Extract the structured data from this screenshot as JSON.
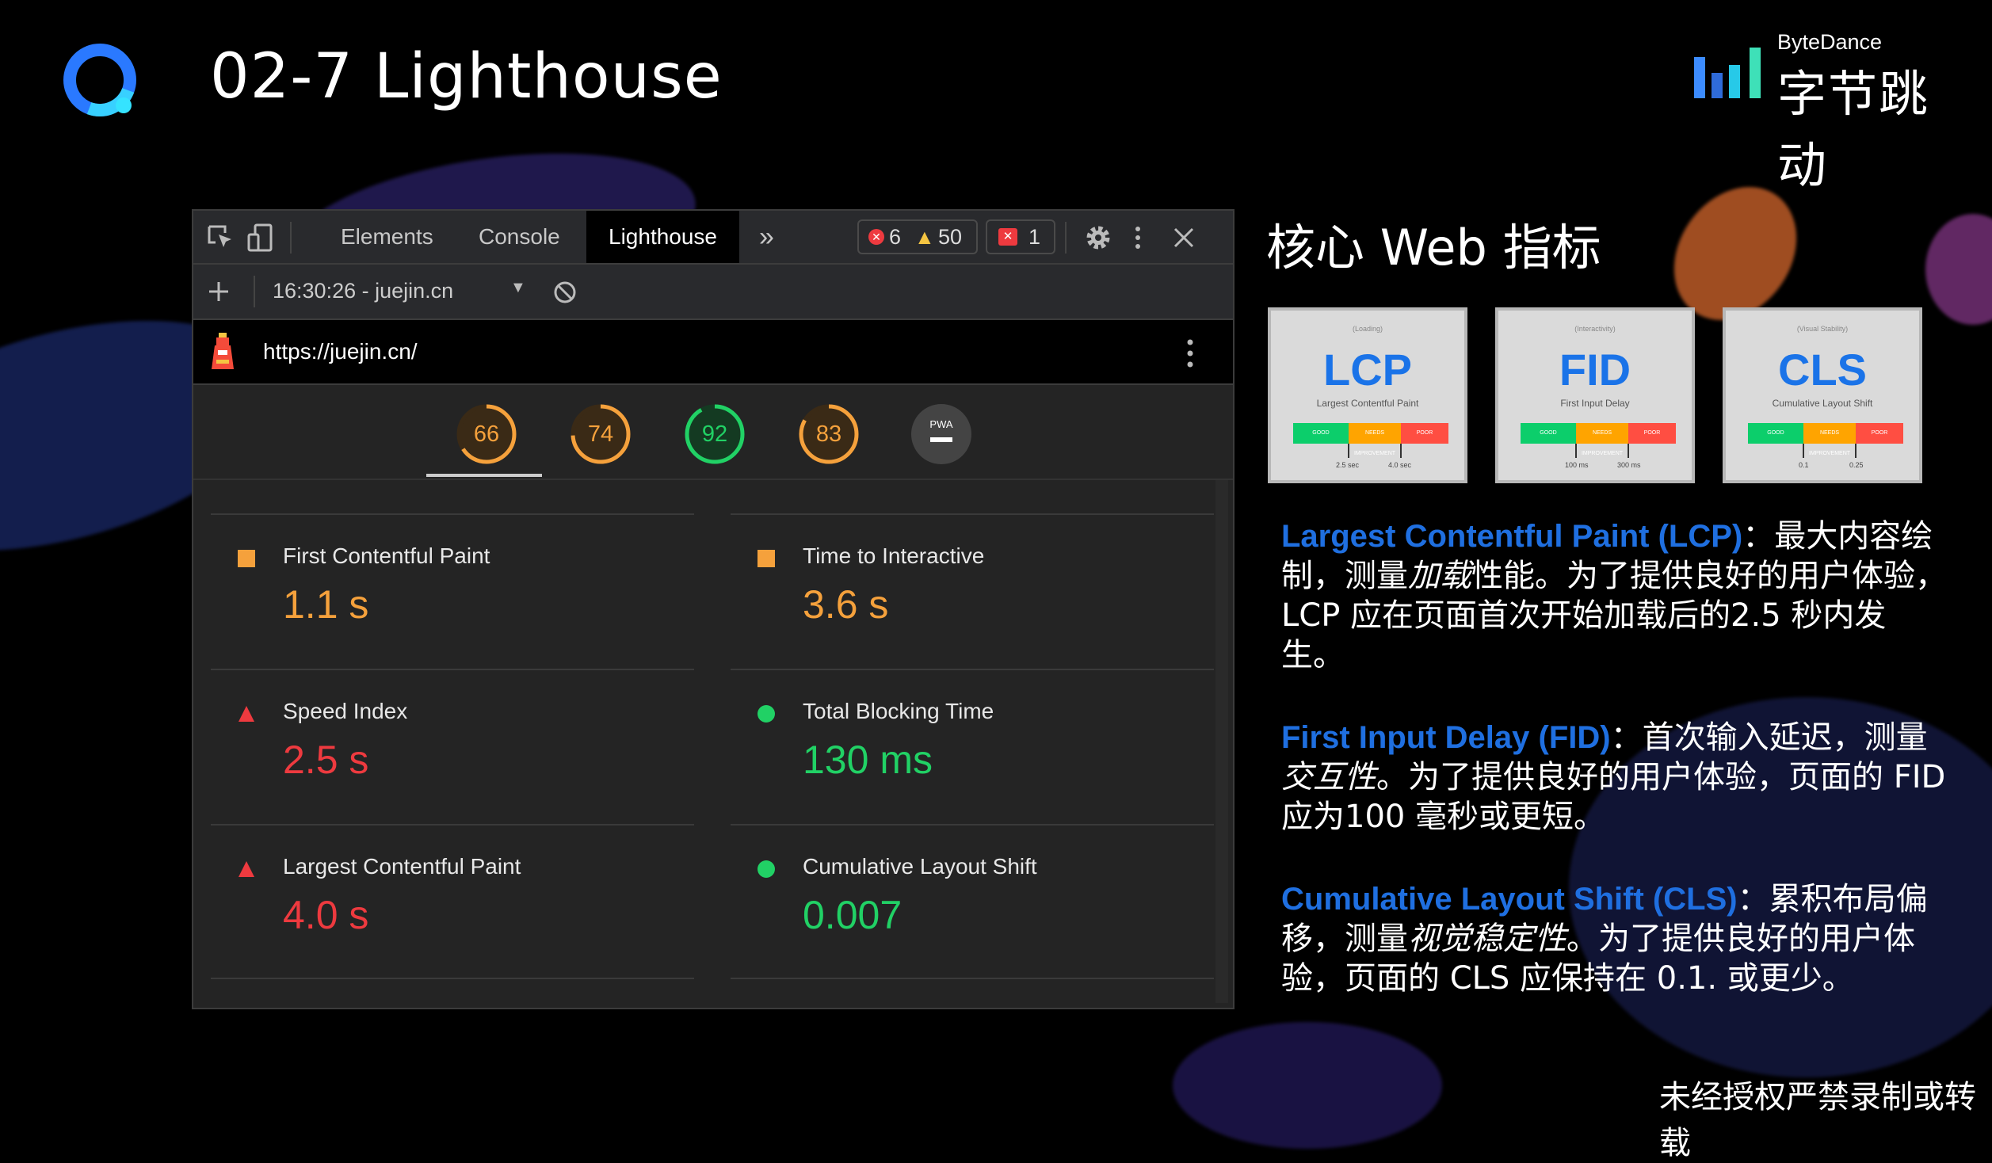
{
  "slide": {
    "title": "02-7 Lighthouse"
  },
  "brand": {
    "english": "ByteDance",
    "chinese": "字节跳动"
  },
  "devtools": {
    "tabs": [
      "Elements",
      "Console",
      "Lighthouse"
    ],
    "active_tab": "Lighthouse",
    "more_tabs": "»",
    "badges": {
      "errors": "6",
      "warnings": "50",
      "issues": "1"
    },
    "report_select": "16:30:26 - juejin.cn",
    "url": "https://juejin.cn/",
    "scores": [
      "66",
      "74",
      "92",
      "83"
    ],
    "pwa_label": "PWA",
    "metrics": [
      {
        "label": "First Contentful Paint",
        "value": "1.1 s",
        "status": "orange"
      },
      {
        "label": "Time to Interactive",
        "value": "3.6 s",
        "status": "orange"
      },
      {
        "label": "Speed Index",
        "value": "2.5 s",
        "status": "red"
      },
      {
        "label": "Total Blocking Time",
        "value": "130 ms",
        "status": "green"
      },
      {
        "label": "Largest Contentful Paint",
        "value": "4.0 s",
        "status": "red"
      },
      {
        "label": "Cumulative Layout Shift",
        "value": "0.007",
        "status": "green"
      }
    ]
  },
  "right": {
    "heading": "核心 Web 指标",
    "cards": [
      {
        "category": "(Loading)",
        "abbr": "LCP",
        "full": "Largest Contentful Paint",
        "t1": "2.5 sec",
        "t2": "4.0 sec"
      },
      {
        "category": "(Interactivity)",
        "abbr": "FID",
        "full": "First Input Delay",
        "t1": "100 ms",
        "t2": "300 ms"
      },
      {
        "category": "(Visual Stability)",
        "abbr": "CLS",
        "full": "Cumulative Layout Shift",
        "t1": "0.1",
        "t2": "0.25"
      }
    ],
    "bar_labels": {
      "good": "GOOD",
      "needs": "NEEDS IMPROVEMENT",
      "poor": "POOR"
    },
    "lcp": {
      "kw": "Largest Contentful Paint (LCP)",
      "a": "：最大内容绘制，测量",
      "em": "加载",
      "b": "性能。为了提供良好的用户体验，LCP 应在页面首次开始加载后的2.5 秒内发生。"
    },
    "fid": {
      "kw": "First Input Delay (FID)",
      "a": "：首次输入延迟，测量",
      "em": "交互性",
      "b": "。为了提供良好的用户体验，页面的 FID 应为100 毫秒或更短。"
    },
    "cls": {
      "kw": "Cumulative Layout Shift (CLS)",
      "a": "：累积布局偏移，测量",
      "em": "视觉稳定性",
      "b": "。为了提供良好的用户体验，页面的 CLS 应保持在 0.1. 或更少。"
    }
  },
  "footer": "未经授权严禁录制或转载",
  "colors": {
    "orange": "#f5a13c",
    "red": "#ee3a3f",
    "green": "#21d165",
    "accent_blue": "#1f6fe0"
  }
}
